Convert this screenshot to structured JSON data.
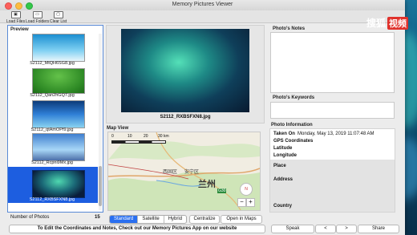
{
  "window": {
    "title": "Memory Pictures Viewer"
  },
  "toolbar": {
    "load_files": "Load Files",
    "load_folders": "Load Folders",
    "clear_list": "Clear List"
  },
  "preview": {
    "header": "Preview",
    "items": [
      {
        "name": "S2112_MtQH6SG8.jpg",
        "selected": false
      },
      {
        "name": "S2112_Qan2hGQ7.jpg",
        "selected": false
      },
      {
        "name": "S2112_qtAmOPf9.jpg",
        "selected": false
      },
      {
        "name": "S2112_Rcpni9Mx.jpg",
        "selected": false
      },
      {
        "name": "S2112_RXBSFXN8.jpg",
        "selected": true
      }
    ],
    "count_label": "Number of Photos",
    "count": "15"
  },
  "main_photo": {
    "filename": "S2112_RXBSFXN8.jpg"
  },
  "map": {
    "header": "Map View",
    "scale_labels": [
      "0",
      "10",
      "20",
      "30 km"
    ],
    "place_labels": [
      "西固区",
      "安宁区",
      "兰州",
      "G30"
    ],
    "modes": [
      "Standard",
      "Satellite",
      "Hybrid"
    ],
    "selected_mode": "Standard",
    "centralize": "Centralize",
    "open_in_maps": "Open in Maps"
  },
  "notes": {
    "header": "Photo's Notes"
  },
  "keywords": {
    "header": "Photo's Keywords"
  },
  "photo_info": {
    "header": "Photo Information",
    "taken_on_label": "Taken On",
    "taken_on_value": "Monday, May 13, 2019 11:07:48 AM",
    "gps_label": "GPS Coordinates",
    "latitude_label": "Latitude",
    "longitude_label": "Longitude",
    "place_label": "Place",
    "address_label": "Address",
    "country_label": "Country"
  },
  "bottom": {
    "link_text": "To Edit the Coordinates and Notes, Check out our Memory Pictures App on our website",
    "speak": "Speak",
    "prev": "<",
    "next": ">",
    "share": "Share"
  },
  "watermark": {
    "text1": "搜狐",
    "text2": "视频"
  },
  "colors": {
    "selection": "#1d5ee0",
    "accent": "#2a6ff0"
  }
}
